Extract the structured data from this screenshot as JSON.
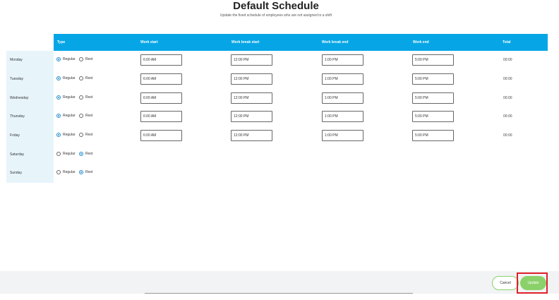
{
  "header": {
    "title": "Default Schedule",
    "subtitle": "Update the fixed schedule of employees who are not assigned to a shift"
  },
  "columns": {
    "type": "Type",
    "work_start": "Work start",
    "break_start": "Work break start",
    "break_end": "Work break end",
    "work_end": "Work end",
    "total": "Total"
  },
  "radio_labels": {
    "regular": "Regular",
    "rest": "Rest"
  },
  "rows": [
    {
      "day": "Monday",
      "type": "Regular",
      "work_start": "6:00 AM",
      "break_start": "12:00 PM",
      "break_end": "1:00 PM",
      "work_end": "5:00 PM",
      "total": "00:00"
    },
    {
      "day": "Tuesday",
      "type": "Regular",
      "work_start": "6:00 AM",
      "break_start": "12:00 PM",
      "break_end": "1:00 PM",
      "work_end": "5:00 PM",
      "total": "00:00"
    },
    {
      "day": "Wednesday",
      "type": "Regular",
      "work_start": "6:00 AM",
      "break_start": "12:00 PM",
      "break_end": "1:00 PM",
      "work_end": "5:00 PM",
      "total": "00:00"
    },
    {
      "day": "Thursday",
      "type": "Regular",
      "work_start": "6:00 AM",
      "break_start": "12:00 PM",
      "break_end": "1:00 PM",
      "work_end": "5:00 PM",
      "total": "00:00"
    },
    {
      "day": "Friday",
      "type": "Regular",
      "work_start": "6:00 AM",
      "break_start": "12:00 PM",
      "break_end": "1:00 PM",
      "work_end": "5:00 PM",
      "total": "00:00"
    },
    {
      "day": "Saturday",
      "type": "Rest"
    },
    {
      "day": "Sunday",
      "type": "Rest"
    }
  ],
  "footer": {
    "cancel_label": "Cancel",
    "update_label": "Update"
  },
  "colors": {
    "header_bg": "#06a6e6",
    "accent_green": "#8bd16a",
    "radio_selected": "#1d8ccf",
    "highlight": "#e0202a"
  }
}
